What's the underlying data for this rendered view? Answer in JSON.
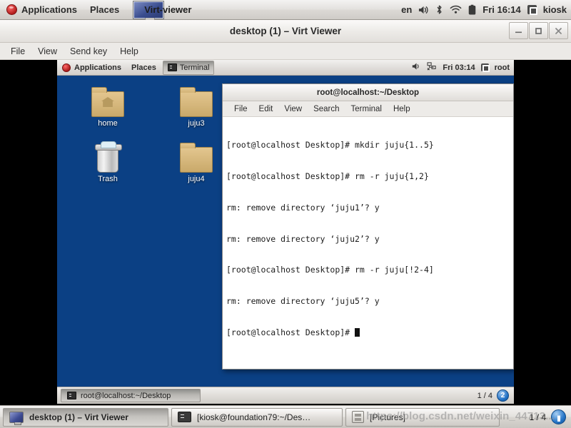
{
  "host_panel": {
    "applications": "Applications",
    "places": "Places",
    "active_window": "Virt-viewer",
    "tray": {
      "keyboard": "en",
      "volume_icon": "speaker-icon",
      "bluetooth_icon": "bluetooth-icon",
      "wifi_icon": "wifi-icon",
      "battery_icon": "battery-icon",
      "clock": "Fri 16:14",
      "user": "kiosk"
    }
  },
  "virt_viewer": {
    "title": "desktop (1) – Virt Viewer",
    "buttons": {
      "minimize": "_",
      "maximize": "□",
      "close": "✕"
    },
    "menu": [
      "File",
      "View",
      "Send key",
      "Help"
    ]
  },
  "guest": {
    "panel": {
      "applications": "Applications",
      "places": "Places",
      "task": "Terminal",
      "tray": {
        "volume_icon": "speaker-icon",
        "network_icon": "network-disconnected-icon",
        "clock": "Fri 03:14",
        "user": "root"
      }
    },
    "desktop_icons": [
      {
        "name": "home",
        "type": "folder-home"
      },
      {
        "name": "juju3",
        "type": "folder"
      },
      {
        "name": "Trash",
        "type": "trash"
      },
      {
        "name": "juju4",
        "type": "folder"
      }
    ],
    "terminal": {
      "title": "root@localhost:~/Desktop",
      "menu": [
        "File",
        "Edit",
        "View",
        "Search",
        "Terminal",
        "Help"
      ],
      "lines": [
        "[root@localhost Desktop]# mkdir juju{1..5}",
        "[root@localhost Desktop]# rm -r juju{1,2}",
        "rm: remove directory ‘juju1’? y",
        "rm: remove directory ‘juju2’? y",
        "[root@localhost Desktop]# rm -r juju[!2-4]",
        "rm: remove directory ‘juju5’? y"
      ],
      "prompt": "[root@localhost Desktop]# "
    },
    "taskbar": {
      "task": "root@localhost:~/Desktop",
      "pager_label": "1 / 4",
      "workspace_badge": "2"
    }
  },
  "host_taskbar": {
    "items": [
      {
        "label": "desktop (1) – Virt Viewer",
        "icon": "monitor-icon",
        "active": true
      },
      {
        "label": "[kiosk@foundation79:~/Des…",
        "icon": "terminal-icon",
        "active": false
      },
      {
        "label": "[Pictures]",
        "icon": "file-manager-icon",
        "active": false
      }
    ],
    "pager_label": "1 / 4",
    "workspace_badge": "ws-badge-icon"
  },
  "watermark": "https://blog.csdn.net/weixin_44713...",
  "colors": {
    "desktop_blue": "#0b4084",
    "panel_grey": "#e3e1de",
    "terminal_bg": "#ffffff",
    "accent_blue": "#2676c8"
  }
}
